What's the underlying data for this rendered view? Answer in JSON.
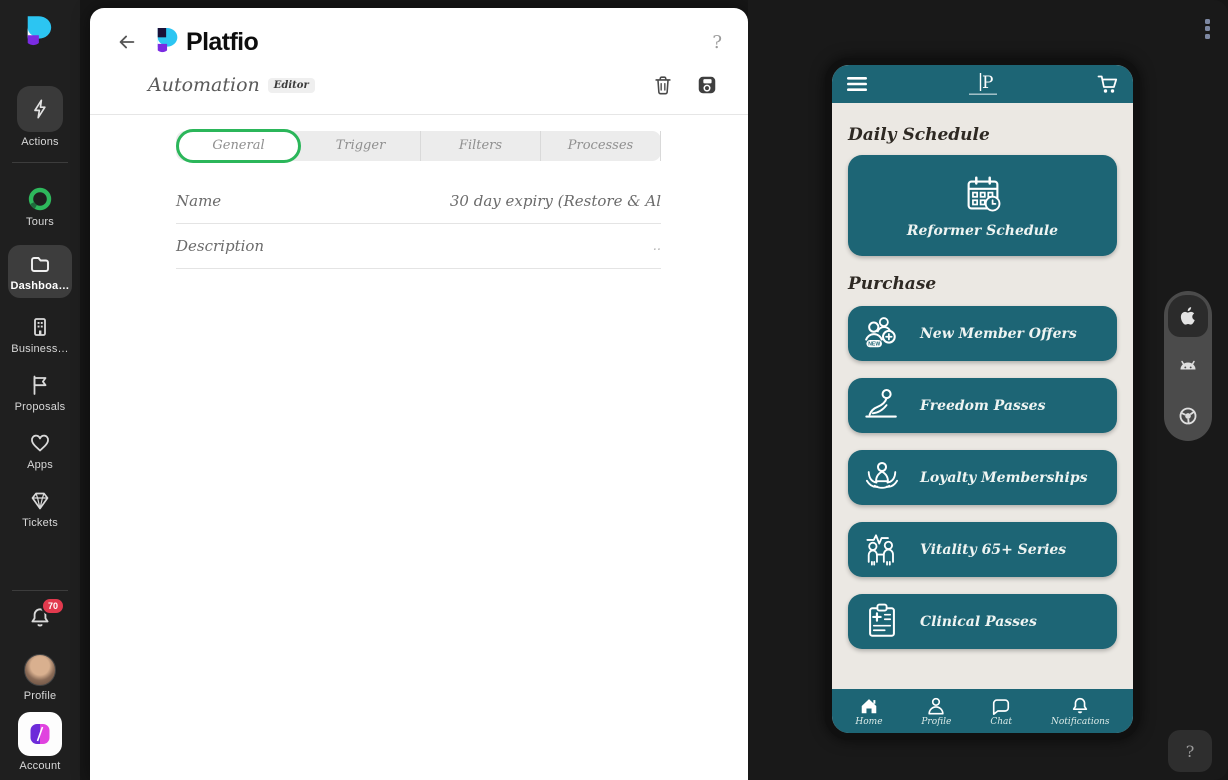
{
  "colors": {
    "teal": "#1d6575",
    "tab_active_border": "#2bb65a",
    "badge_red": "#e23a4e",
    "logo_cyan": "#2cc5f2",
    "logo_purple": "#7a2be2",
    "logo_navy": "#1a1038",
    "account_purple": "#6d2bd9",
    "account_pink": "#e043df"
  },
  "sidebar": {
    "items": [
      {
        "label": "Actions",
        "icon": "lightning-icon"
      },
      {
        "label": "Tours",
        "icon": "ring-icon"
      },
      {
        "label": "Dashboa…",
        "icon": "folder-icon",
        "active": true
      },
      {
        "label": "Business…",
        "icon": "building-icon"
      },
      {
        "label": "Proposals",
        "icon": "flag-icon"
      },
      {
        "label": "Apps",
        "icon": "heart-icon"
      },
      {
        "label": "Tickets",
        "icon": "gem-icon"
      }
    ],
    "notifications": {
      "icon": "bell-icon",
      "count": "70"
    },
    "profile": {
      "label": "Profile",
      "icon": "avatar"
    },
    "account": {
      "label": "Account",
      "icon": "account-logo"
    }
  },
  "editor": {
    "brand": "Platfio",
    "help": "?",
    "title": "Automation",
    "badge": "Editor",
    "tabs": [
      {
        "label": "General",
        "active": true
      },
      {
        "label": "Trigger"
      },
      {
        "label": "Filters"
      },
      {
        "label": "Processes"
      }
    ],
    "fields": [
      {
        "label": "Name",
        "value": "30 day expiry (Restore & Al"
      },
      {
        "label": "Description",
        "value": ".."
      }
    ]
  },
  "preview": {
    "menu_icon": "kebab-menu-icon",
    "help_button": "?",
    "platforms": [
      {
        "name": "apple",
        "active": true
      },
      {
        "name": "android",
        "active": false
      },
      {
        "name": "chrome",
        "active": false
      }
    ],
    "phone": {
      "header": {
        "menu_icon": "hamburger-icon",
        "logo": "brand-monogram",
        "cart_icon": "cart-icon"
      },
      "sections": [
        {
          "heading": "Daily Schedule",
          "cards": [
            {
              "label": "Reformer Schedule",
              "icon": "calendar-clock-icon"
            }
          ]
        },
        {
          "heading": "Purchase",
          "cards": [
            {
              "label": "New Member Offers",
              "icon": "new-member-icon",
              "icon_badge": "NEW"
            },
            {
              "label": "Freedom Passes",
              "icon": "freedom-pass-icon"
            },
            {
              "label": "Loyalty Memberships",
              "icon": "lotus-icon"
            },
            {
              "label": "Vitality 65+ Series",
              "icon": "seniors-icon"
            },
            {
              "label": "Clinical Passes",
              "icon": "clinical-icon"
            }
          ]
        }
      ],
      "bottom_nav": [
        {
          "label": "Home",
          "icon": "home-icon",
          "active": true
        },
        {
          "label": "Profile",
          "icon": "person-icon"
        },
        {
          "label": "Chat",
          "icon": "chat-icon"
        },
        {
          "label": "Notifications",
          "icon": "bell-icon"
        }
      ]
    }
  }
}
